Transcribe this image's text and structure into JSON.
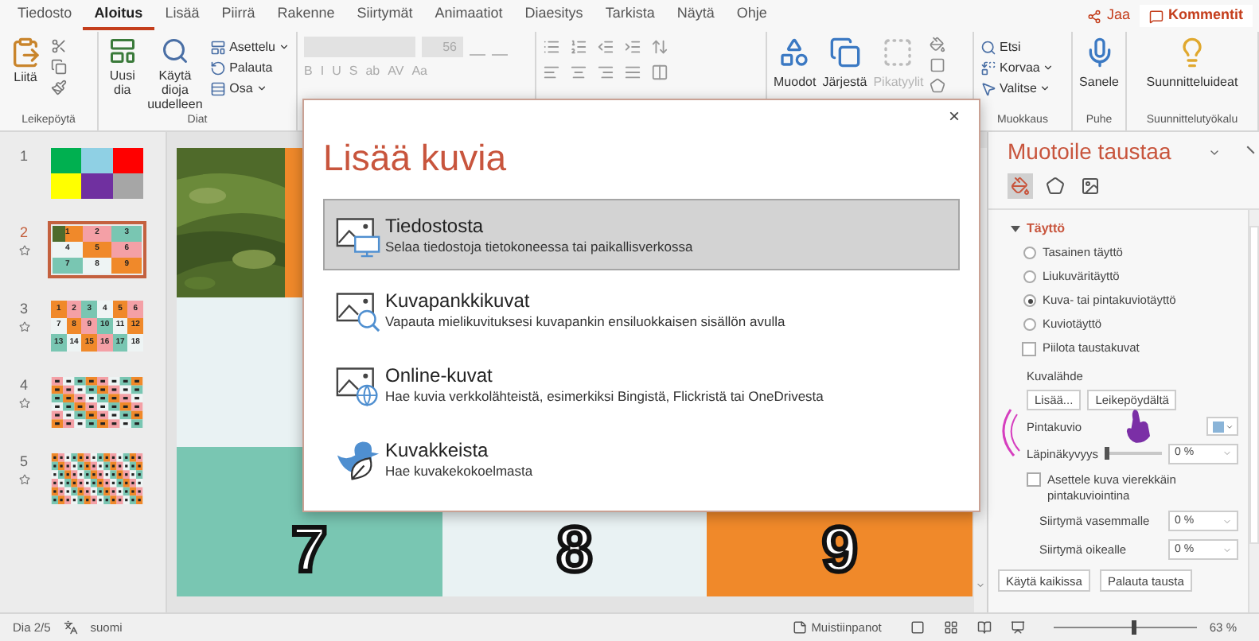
{
  "menu_tabs": [
    {
      "label": "Tiedosto",
      "selected": false
    },
    {
      "label": "Aloitus",
      "selected": true
    },
    {
      "label": "Lisää",
      "selected": false
    },
    {
      "label": "Piirrä",
      "selected": false
    },
    {
      "label": "Rakenne",
      "selected": false
    },
    {
      "label": "Siirtymät",
      "selected": false
    },
    {
      "label": "Animaatiot",
      "selected": false
    },
    {
      "label": "Diaesitys",
      "selected": false
    },
    {
      "label": "Tarkista",
      "selected": false
    },
    {
      "label": "Näytä",
      "selected": false
    },
    {
      "label": "Ohje",
      "selected": false
    }
  ],
  "share": "Jaa",
  "comments": "Kommentit",
  "ribbon": {
    "clipboard": {
      "paste": "Liitä",
      "label": "Leikepöytä"
    },
    "slides": {
      "new_slide": "Uusi dia",
      "reuse": "Käytä dioja uudelleen",
      "layout": "Asettelu",
      "reset": "Palauta",
      "section": "Osa",
      "label": "Diat"
    },
    "font": {
      "size": "56",
      "format_buttons": [
        "B",
        "I",
        "U",
        "S",
        "ab",
        "AV",
        "Aa"
      ]
    },
    "drawing": [
      {
        "label": "Muodot",
        "disabled": false
      },
      {
        "label": "Järjestä",
        "disabled": false
      },
      {
        "label": "Pikatyylit",
        "disabled": true
      }
    ],
    "editing": {
      "find": "Etsi",
      "replace": "Korvaa",
      "select": "Valitse",
      "label": "Muokkaus"
    },
    "voice": {
      "dictate": "Sanele",
      "label": "Puhe"
    },
    "designer": {
      "ideas": "Suunnitteluideat",
      "label": "Suunnittelutyökalu"
    }
  },
  "thumbnails": [
    {
      "number": "1",
      "selected": false,
      "animated": false,
      "kind": "grid",
      "cells": [
        {
          "color": "#00b050"
        },
        {
          "color": "#8fd0e4"
        },
        {
          "color": "#ff0000"
        },
        {
          "color": "#ffff00"
        },
        {
          "color": "#7030a0"
        },
        {
          "color": "#a6a6a6"
        }
      ]
    },
    {
      "number": "2",
      "selected": true,
      "animated": true,
      "kind": "grid",
      "cells": [
        {
          "text": "1",
          "color": "#f0892a",
          "kind": "picture"
        },
        {
          "text": "2",
          "color": "#f4a0a6"
        },
        {
          "text": "3",
          "color": "#79c6b2"
        },
        {
          "text": "4",
          "color": "#eef4f4"
        },
        {
          "text": "5",
          "color": "#f0892a"
        },
        {
          "text": "6",
          "color": "#f4a0a6"
        },
        {
          "text": "7",
          "color": "#79c6b2"
        },
        {
          "text": "8",
          "color": "#eef4f4"
        },
        {
          "text": "9",
          "color": "#f0892a"
        }
      ]
    },
    {
      "number": "3",
      "selected": false,
      "animated": true,
      "kind": "grid",
      "cells": [
        {
          "text": "1",
          "color": "#f0892a"
        },
        {
          "text": "2",
          "color": "#f4a0a6"
        },
        {
          "text": "3",
          "color": "#79c6b2"
        },
        {
          "text": "4",
          "color": "#eef4f4"
        },
        {
          "text": "5",
          "color": "#f0892a"
        },
        {
          "text": "6",
          "color": "#f4a0a6"
        },
        {
          "text": "7",
          "color": "#eef4f4"
        },
        {
          "text": "8",
          "color": "#f0892a"
        },
        {
          "text": "9",
          "color": "#f4a0a6"
        },
        {
          "text": "10",
          "color": "#79c6b2"
        },
        {
          "text": "11",
          "color": "#eef4f4"
        },
        {
          "text": "12",
          "color": "#f0892a"
        },
        {
          "text": "13",
          "color": "#79c6b2"
        },
        {
          "text": "14",
          "color": "#eef4f4"
        },
        {
          "text": "15",
          "color": "#f0892a"
        },
        {
          "text": "16",
          "color": "#f4a0a6"
        },
        {
          "text": "17",
          "color": "#79c6b2"
        },
        {
          "text": "18",
          "color": "#eef4f4"
        }
      ]
    },
    {
      "number": "4",
      "selected": false,
      "animated": true,
      "kind": "pattern"
    },
    {
      "number": "5",
      "selected": false,
      "animated": true,
      "kind": "pattern"
    }
  ],
  "slide": {
    "cells": [
      {
        "color": "#f0892a",
        "kind": "picture"
      },
      {
        "color": "#e9f2f3"
      },
      {
        "color": "#79c6b2",
        "digit": "7"
      },
      {
        "color": "#e9f2f3",
        "digit": "8"
      },
      {
        "color": "#f0892a",
        "digit": "9"
      }
    ]
  },
  "dialog": {
    "title": "Lisää kuvia",
    "close": "×",
    "options": [
      {
        "kind": "file",
        "title": "Tiedostosta",
        "description": "Selaa tiedostoja tietokoneessa tai paikallisverkossa",
        "selected": true
      },
      {
        "kind": "stock",
        "title": "Kuvapankkikuvat",
        "description": "Vapauta mielikuvituksesi kuvapankin ensiluokkaisen sisällön avulla",
        "selected": false
      },
      {
        "kind": "online",
        "title": "Online-kuvat",
        "description": "Hae kuvia verkkolähteistä, esimerkiksi Bingistä, Flickristä tai OneDrivesta",
        "selected": false
      },
      {
        "kind": "icons",
        "title": "Kuvakkeista",
        "description": "Hae kuvakekokoelmasta",
        "selected": false
      }
    ]
  },
  "format_pane": {
    "title": "Muotoile taustaa",
    "tabs": [
      {
        "kind": "fill",
        "selected": true
      },
      {
        "kind": "effects",
        "selected": false
      },
      {
        "kind": "picture",
        "selected": false
      }
    ],
    "section": {
      "label": "Täyttö",
      "expanded": true
    },
    "fill_options": [
      {
        "label": "Tasainen täyttö",
        "selected": false
      },
      {
        "label": "Liukuväritäyttö",
        "selected": false
      },
      {
        "label": "Kuva- tai pintakuviotäyttö",
        "selected": true
      },
      {
        "label": "Kuviotäyttö",
        "selected": false
      }
    ],
    "hide_background": {
      "label": "Piilota taustakuvat",
      "checked": false
    },
    "source_label": "Kuvalähde",
    "source_buttons": [
      "Lisää...",
      "Leikepöydältä"
    ],
    "pattern_label": "Pintakuvio",
    "transparency": {
      "label": "Läpinäkyvyys",
      "level": 0,
      "value": "0 %"
    },
    "tile": {
      "label": "Asettele kuva vierekkäin pintakuviointina",
      "checked": false
    },
    "offsets": [
      {
        "label": "Siirtymä vasemmalle",
        "value": "0 %"
      },
      {
        "label": "Siirtymä oikealle",
        "value": "0 %"
      }
    ],
    "buttons": [
      "Käytä kaikissa",
      "Palauta tausta"
    ]
  },
  "status": {
    "slide": "Dia 2/5",
    "language": "suomi",
    "notes": "Muistiinpanot",
    "zoom": {
      "level": 0.55,
      "value": "63 %"
    }
  }
}
